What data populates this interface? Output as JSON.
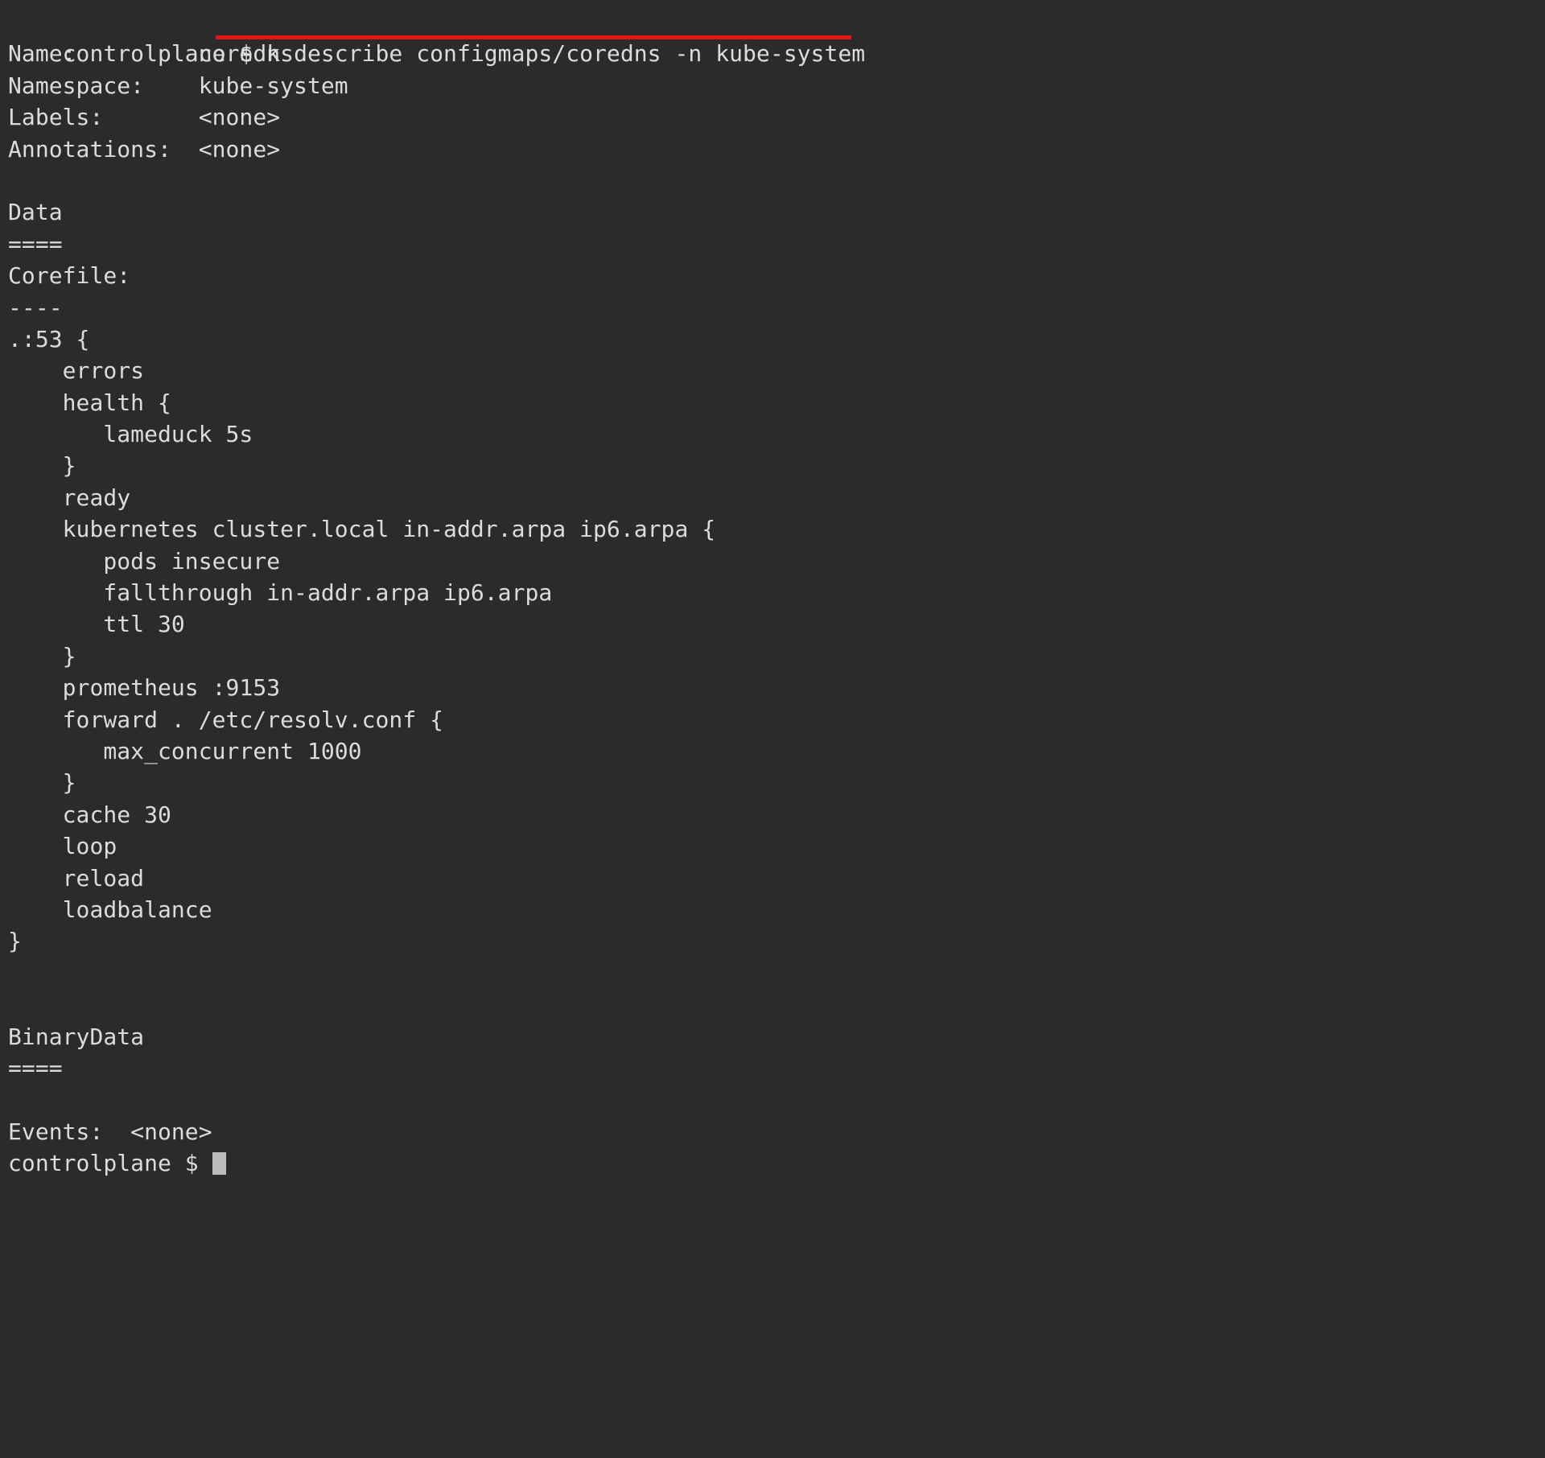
{
  "terminal": {
    "background_color": "#2b2b2b",
    "text_color": "#dcdcdc",
    "annotation_color": "#e21414",
    "cursor_color": "#bdbdbd",
    "prompt": "controlplane $",
    "command": "k describe configmaps/coredns -n kube-system",
    "lines": [
      {
        "id": "l00",
        "text": "controlplane $ k describe configmaps/coredns -n kube-system"
      },
      {
        "id": "l01",
        "text": "Name:         coredns"
      },
      {
        "id": "l02",
        "text": "Namespace:    kube-system"
      },
      {
        "id": "l03",
        "text": "Labels:       <none>"
      },
      {
        "id": "l04",
        "text": "Annotations:  <none>"
      },
      {
        "id": "l05",
        "text": ""
      },
      {
        "id": "l06",
        "text": "Data"
      },
      {
        "id": "l07",
        "text": "===="
      },
      {
        "id": "l08",
        "text": "Corefile:"
      },
      {
        "id": "l09",
        "text": "----"
      },
      {
        "id": "l10",
        "text": ".:53 {"
      },
      {
        "id": "l11",
        "text": "    errors"
      },
      {
        "id": "l12",
        "text": "    health {"
      },
      {
        "id": "l13",
        "text": "       lameduck 5s"
      },
      {
        "id": "l14",
        "text": "    }"
      },
      {
        "id": "l15",
        "text": "    ready"
      },
      {
        "id": "l16",
        "text": "    kubernetes cluster.local in-addr.arpa ip6.arpa {"
      },
      {
        "id": "l17",
        "text": "       pods insecure"
      },
      {
        "id": "l18",
        "text": "       fallthrough in-addr.arpa ip6.arpa"
      },
      {
        "id": "l19",
        "text": "       ttl 30"
      },
      {
        "id": "l20",
        "text": "    }"
      },
      {
        "id": "l21",
        "text": "    prometheus :9153"
      },
      {
        "id": "l22",
        "text": "    forward . /etc/resolv.conf {"
      },
      {
        "id": "l23",
        "text": "       max_concurrent 1000"
      },
      {
        "id": "l24",
        "text": "    }"
      },
      {
        "id": "l25",
        "text": "    cache 30"
      },
      {
        "id": "l26",
        "text": "    loop"
      },
      {
        "id": "l27",
        "text": "    reload"
      },
      {
        "id": "l28",
        "text": "    loadbalance"
      },
      {
        "id": "l29",
        "text": "}"
      },
      {
        "id": "l30",
        "text": ""
      },
      {
        "id": "l31",
        "text": ""
      },
      {
        "id": "l32",
        "text": "BinaryData"
      },
      {
        "id": "l33",
        "text": "===="
      },
      {
        "id": "l34",
        "text": ""
      },
      {
        "id": "l35",
        "text": "Events:  <none>"
      }
    ],
    "final_prompt": "controlplane $ ",
    "describe_output": {
      "name_label": "Name:",
      "name_value": "coredns",
      "namespace_label": "Namespace:",
      "namespace_value": "kube-system",
      "labels_label": "Labels:",
      "labels_value": "<none>",
      "annotations_label": "Annotations:",
      "annotations_value": "<none>",
      "data_heading": "Data",
      "data_rule": "====",
      "corefile_key": "Corefile:",
      "corefile_rule": "----",
      "binarydata_heading": "BinaryData",
      "binarydata_rule": "====",
      "events_label": "Events:",
      "events_value": "<none>"
    }
  }
}
